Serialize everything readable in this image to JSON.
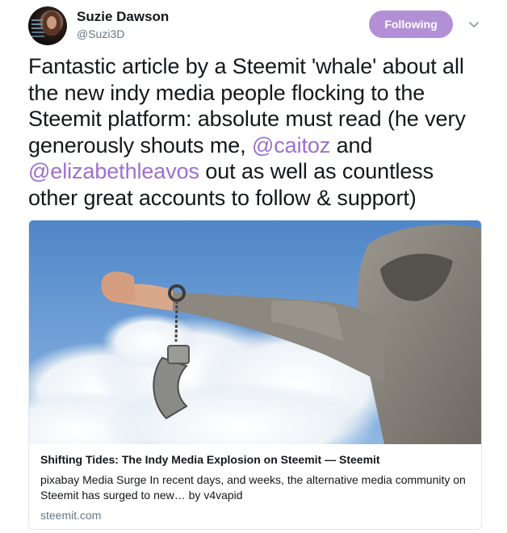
{
  "user": {
    "name": "Suzie Dawson",
    "handle": "@Suzi3D"
  },
  "follow_button": {
    "label": "Following",
    "color": "#b38fd6"
  },
  "menu_icon": "chevron-down-icon",
  "tweet": {
    "text_before_1": "Fantastic article by a Steemit 'whale' about all the new indy media people flocking to the Steemit platform: absolute must read (he very generously shouts me, ",
    "mention_1": "@caitoz",
    "text_between": " and ",
    "mention_2": "@elizabethleavos",
    "text_after": " out as well as countless other great accounts to follow & support)",
    "mention_color": "#9d6fcf"
  },
  "card": {
    "title": "Shifting Tides: The Indy Media Explosion on Steemit — Steemit",
    "description": "pixabay Media Surge In recent days, and weeks, the alternative media community on Steemit has surged to new… by v4vapid",
    "domain": "steemit.com",
    "image_subject": "hooded person holding open handcuffs against blue sky with clouds"
  }
}
